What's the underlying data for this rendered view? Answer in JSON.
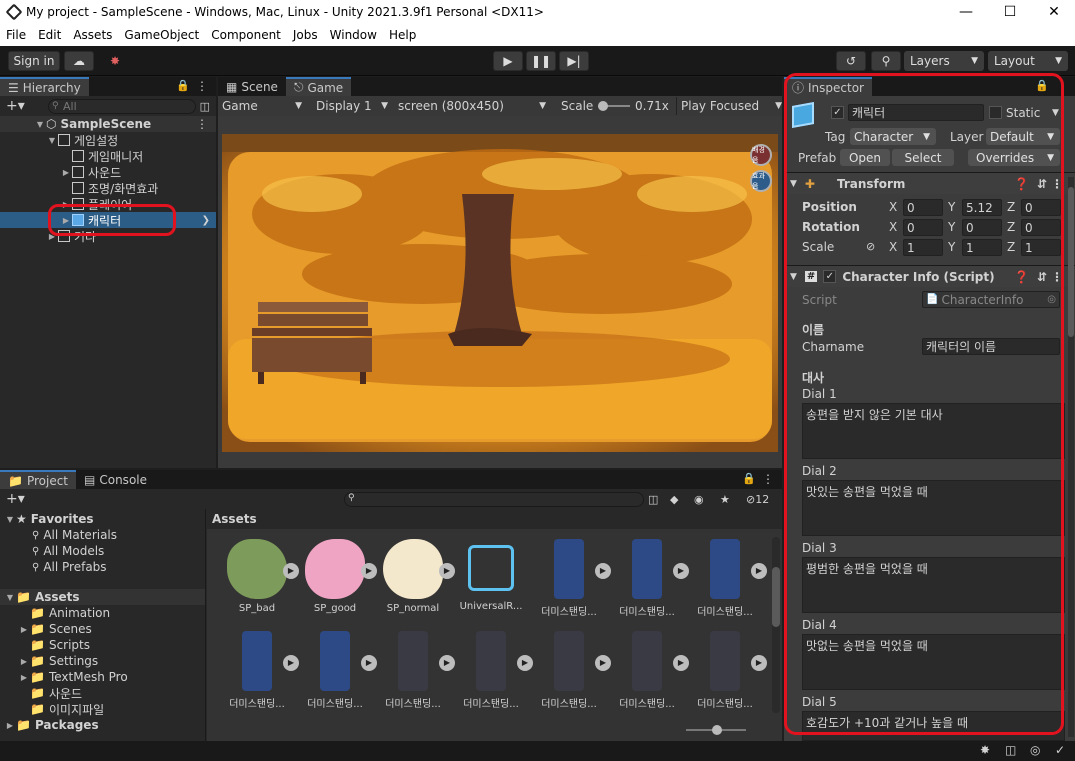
{
  "window": {
    "title": "My project - SampleScene - Windows, Mac, Linux - Unity 2021.3.9f1 Personal <DX11>"
  },
  "menu": [
    "File",
    "Edit",
    "Assets",
    "GameObject",
    "Component",
    "Jobs",
    "Window",
    "Help"
  ],
  "toolbar": {
    "sign_in": "Sign in",
    "layers": "Layers",
    "layout": "Layout"
  },
  "hierarchy": {
    "tab": "Hierarchy",
    "search_placeholder": "All",
    "items": [
      {
        "label": "SampleScene",
        "depth": 0,
        "expanded": true,
        "bold": true,
        "icon": "unity-scene-icon"
      },
      {
        "label": "게임설정",
        "depth": 1,
        "expanded": true,
        "icon": "cube-icon"
      },
      {
        "label": "게임매니저",
        "depth": 2,
        "expanded": null,
        "icon": "cube-icon"
      },
      {
        "label": "사운드",
        "depth": 2,
        "expanded": false,
        "icon": "cube-icon"
      },
      {
        "label": "조명/화면효과",
        "depth": 2,
        "expanded": null,
        "icon": "cube-icon"
      },
      {
        "label": "플레이어",
        "depth": 2,
        "expanded": false,
        "icon": "cube-icon"
      },
      {
        "label": "캐릭터",
        "depth": 2,
        "expanded": false,
        "icon": "cube-icon",
        "selected": true
      },
      {
        "label": "기타",
        "depth": 1,
        "expanded": false,
        "icon": "cube-icon"
      }
    ]
  },
  "game": {
    "tabs": [
      "Scene",
      "Game"
    ],
    "mode": "Game",
    "display": "Display 1",
    "resolution": "screen (800x450)",
    "scale_label": "Scale",
    "scale_value": "0.71x",
    "play_mode": "Play Focused",
    "badges": [
      "배경음",
      "효과음"
    ]
  },
  "project": {
    "tabs": [
      "Project",
      "Console"
    ],
    "hidden_count": "12",
    "favorites_label": "Favorites",
    "favorites": [
      "All Materials",
      "All Models",
      "All Prefabs"
    ],
    "assets_label": "Assets",
    "folders": [
      "Animation",
      "Scenes",
      "Scripts",
      "Settings",
      "TextMesh Pro",
      "사운드",
      "이미지파일"
    ],
    "packages_label": "Packages",
    "breadcrumb": "Assets",
    "assets_row1": [
      "SP_bad",
      "SP_good",
      "SP_normal",
      "UniversalR...",
      "더미스탠딩...",
      "더미스탠딩...",
      "더미스탠딩..."
    ],
    "assets_row2": [
      "더미스탠딩...",
      "더미스탠딩...",
      "더미스탠딩...",
      "더미스탠딩...",
      "더미스탠딩...",
      "더미스탠딩...",
      "더미스탠딩..."
    ]
  },
  "inspector": {
    "tab": "Inspector",
    "object_name": "캐릭터",
    "static_label": "Static",
    "tag_label": "Tag",
    "tag_value": "Character",
    "layer_label": "Layer",
    "layer_value": "Default",
    "prefab_label": "Prefab",
    "open": "Open",
    "select": "Select",
    "overrides": "Overrides",
    "transform": {
      "title": "Transform",
      "position": {
        "label": "Position",
        "x": "0",
        "y": "5.12",
        "z": "0"
      },
      "rotation": {
        "label": "Rotation",
        "x": "0",
        "y": "0",
        "z": "0"
      },
      "scale": {
        "label": "Scale",
        "x": "1",
        "y": "1",
        "z": "1"
      }
    },
    "script_comp": {
      "title": "Character Info (Script)",
      "script_label": "Script",
      "script_value": "CharacterInfo",
      "section_name": "이름",
      "charname_label": "Charname",
      "charname_value": "캐릭터의 이름",
      "section_dialog": "대사",
      "dials": [
        {
          "label": "Dial 1",
          "value": "송편을 받지 않은 기본 대사"
        },
        {
          "label": "Dial 2",
          "value": "맛있는 송편을 먹었을 때"
        },
        {
          "label": "Dial 3",
          "value": "평범한 송편을 먹었을 때"
        },
        {
          "label": "Dial 4",
          "value": "맛없는 송편을 먹었을 때"
        },
        {
          "label": "Dial 5",
          "value": "호감도가 +10과 같거나 높을 때"
        }
      ]
    }
  },
  "axis_labels": {
    "x": "X",
    "y": "Y",
    "z": "Z"
  }
}
